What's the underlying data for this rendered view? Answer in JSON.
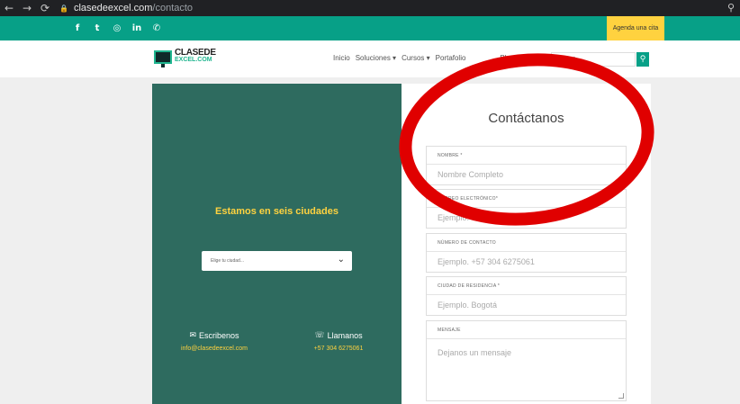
{
  "browser": {
    "back": "←",
    "forward": "→",
    "reload": "⟳",
    "domain": "clasedeexcel.com",
    "path": "/contacto",
    "search_icon": "⚲"
  },
  "social": {
    "icons": [
      "f",
      "t",
      "◎",
      "in",
      "✆"
    ],
    "icon_names": [
      "facebook-icon",
      "twitter-icon",
      "instagram-icon",
      "linkedin-icon",
      "whatsapp-icon"
    ],
    "cta": "Agenda una cita"
  },
  "header": {
    "logo_line1": "CLASEDE",
    "logo_line2": "EXCEL.COM",
    "menu": [
      "Inicio",
      "Soluciones ▾",
      "Cursos ▾",
      "Portafolio",
      "",
      "Blog",
      "Contac"
    ],
    "search_placeholder": "Buscar...",
    "search_icon": "⚲"
  },
  "left": {
    "title": "Estamos en seis ciudades",
    "select_placeholder": "Elige tu ciudad...",
    "chevron": "⌄",
    "write_label": "Escribenos",
    "write_icon": "✉",
    "write_value": "info@clasedeexcel.com",
    "call_label": "Llamanos",
    "call_icon": "☏",
    "call_value": "+57 304 6275061"
  },
  "form": {
    "title": "Contáctanos",
    "fields": [
      {
        "label": "NOMBRE *",
        "placeholder": "Nombre Completo"
      },
      {
        "label": "CORREO ELECTRÓNICO*",
        "placeholder": "Ejemplo. example@mail.com"
      },
      {
        "label": "NÚMERO DE CONTACTO",
        "placeholder": "Ejemplo. +57 304 6275061"
      },
      {
        "label": "CIUDAD DE RESIDENCIA *",
        "placeholder": "Ejemplo. Bogotá"
      },
      {
        "label": "MENSAJE",
        "placeholder": "Dejanos un mensaje"
      }
    ]
  },
  "colors": {
    "teal": "#07a087",
    "dark_green": "#2e6b5f",
    "yellow": "#ffd23f",
    "annotation_red": "#e00000"
  }
}
